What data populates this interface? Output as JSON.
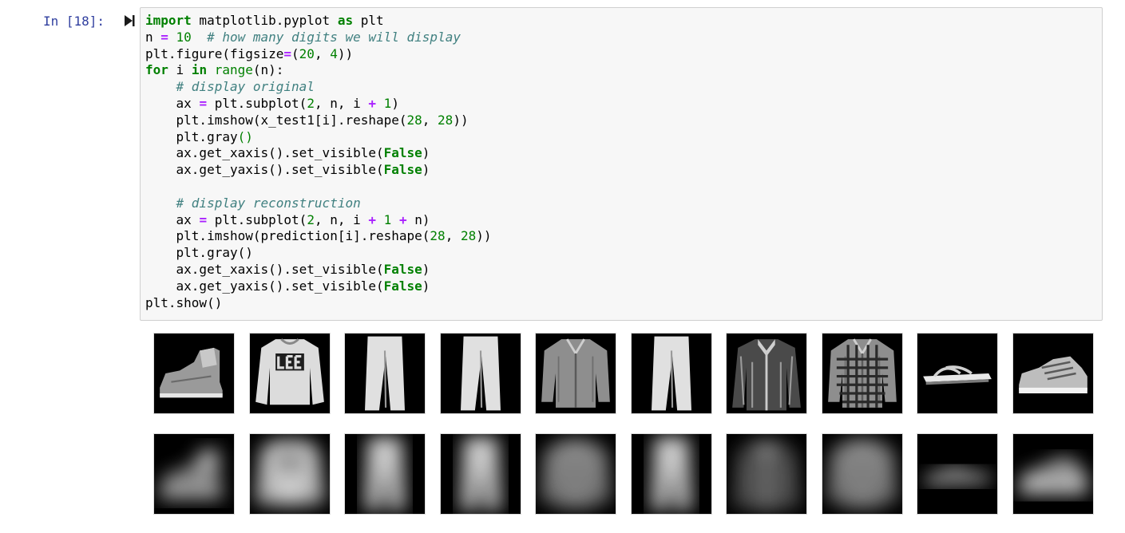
{
  "cell": {
    "prompt": "In [18]:",
    "run_icon": "run-icon",
    "code_lines": [
      [
        {
          "t": "import",
          "c": "kw"
        },
        {
          "t": " matplotlib.pyplot "
        },
        {
          "t": "as",
          "c": "kw"
        },
        {
          "t": " plt"
        }
      ],
      [
        {
          "t": "n "
        },
        {
          "t": "=",
          "c": "op"
        },
        {
          "t": " "
        },
        {
          "t": "10",
          "c": "num"
        },
        {
          "t": "  "
        },
        {
          "t": "# how many digits we will display",
          "c": "cmt"
        }
      ],
      [
        {
          "t": "plt.figure(figsize"
        },
        {
          "t": "=",
          "c": "op"
        },
        {
          "t": "("
        },
        {
          "t": "20",
          "c": "num"
        },
        {
          "t": ", "
        },
        {
          "t": "4",
          "c": "num"
        },
        {
          "t": "))"
        }
      ],
      [
        {
          "t": "for",
          "c": "kw"
        },
        {
          "t": " i "
        },
        {
          "t": "in",
          "c": "kw"
        },
        {
          "t": " "
        },
        {
          "t": "range",
          "c": "bi"
        },
        {
          "t": "(n):"
        }
      ],
      [
        {
          "t": "    "
        },
        {
          "t": "# display original",
          "c": "cmt"
        }
      ],
      [
        {
          "t": "    ax "
        },
        {
          "t": "=",
          "c": "op"
        },
        {
          "t": " plt.subplot("
        },
        {
          "t": "2",
          "c": "num"
        },
        {
          "t": ", n, i "
        },
        {
          "t": "+",
          "c": "op"
        },
        {
          "t": " "
        },
        {
          "t": "1",
          "c": "num"
        },
        {
          "t": ")"
        }
      ],
      [
        {
          "t": "    plt.imshow(x_test1[i].reshape("
        },
        {
          "t": "28",
          "c": "num"
        },
        {
          "t": ", "
        },
        {
          "t": "28",
          "c": "num"
        },
        {
          "t": "))"
        }
      ],
      [
        {
          "t": "    plt.gray"
        },
        {
          "t": "()",
          "c": "bi"
        }
      ],
      [
        {
          "t": "    ax.get_xaxis().set_visible("
        },
        {
          "t": "False",
          "c": "kw"
        },
        {
          "t": ")"
        }
      ],
      [
        {
          "t": "    ax.get_yaxis().set_visible("
        },
        {
          "t": "False",
          "c": "kw"
        },
        {
          "t": ")"
        }
      ],
      [],
      [
        {
          "t": "    "
        },
        {
          "t": "# display reconstruction",
          "c": "cmt"
        }
      ],
      [
        {
          "t": "    ax "
        },
        {
          "t": "=",
          "c": "op"
        },
        {
          "t": " plt.subplot("
        },
        {
          "t": "2",
          "c": "num"
        },
        {
          "t": ", n, i "
        },
        {
          "t": "+",
          "c": "op"
        },
        {
          "t": " "
        },
        {
          "t": "1",
          "c": "num"
        },
        {
          "t": " "
        },
        {
          "t": "+",
          "c": "op"
        },
        {
          "t": " n)"
        }
      ],
      [
        {
          "t": "    plt.imshow(prediction[i].reshape("
        },
        {
          "t": "28",
          "c": "num"
        },
        {
          "t": ", "
        },
        {
          "t": "28",
          "c": "num"
        },
        {
          "t": "))"
        }
      ],
      [
        {
          "t": "    plt.gray()"
        }
      ],
      [
        {
          "t": "    ax.get_xaxis().set_visible("
        },
        {
          "t": "False",
          "c": "kw"
        },
        {
          "t": ")"
        }
      ],
      [
        {
          "t": "    ax.get_yaxis().set_visible("
        },
        {
          "t": "False",
          "c": "kw"
        },
        {
          "t": ")"
        }
      ],
      [
        {
          "t": "plt.show()"
        }
      ]
    ]
  },
  "output": {
    "original_row": [
      "ankle-boot",
      "pullover",
      "trouser",
      "trouser",
      "shirt",
      "trouser",
      "coat",
      "shirt",
      "sandal",
      "sneaker"
    ],
    "reconstruction_row": [
      "ankle-boot",
      "pullover",
      "trouser",
      "trouser",
      "shirt",
      "trouser",
      "coat",
      "shirt",
      "sandal",
      "sneaker"
    ]
  },
  "colors": {
    "keyword": "#008000",
    "operator": "#aa22ff",
    "comment": "#408080",
    "prompt": "#303f9f",
    "cell_bg": "#f7f7f7",
    "cell_border": "#cfcfcf"
  }
}
